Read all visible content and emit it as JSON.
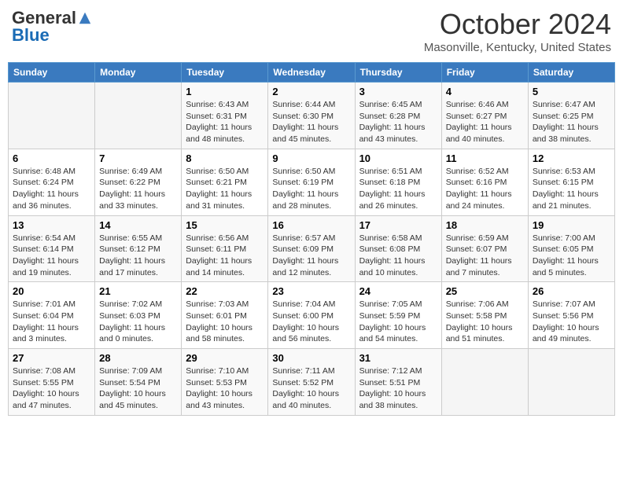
{
  "header": {
    "logo_general": "General",
    "logo_blue": "Blue",
    "month_title": "October 2024",
    "location": "Masonville, Kentucky, United States"
  },
  "weekdays": [
    "Sunday",
    "Monday",
    "Tuesday",
    "Wednesday",
    "Thursday",
    "Friday",
    "Saturday"
  ],
  "weeks": [
    [
      {
        "day": "",
        "sunrise": "",
        "sunset": "",
        "daylight": ""
      },
      {
        "day": "",
        "sunrise": "",
        "sunset": "",
        "daylight": ""
      },
      {
        "day": "1",
        "sunrise": "Sunrise: 6:43 AM",
        "sunset": "Sunset: 6:31 PM",
        "daylight": "Daylight: 11 hours and 48 minutes."
      },
      {
        "day": "2",
        "sunrise": "Sunrise: 6:44 AM",
        "sunset": "Sunset: 6:30 PM",
        "daylight": "Daylight: 11 hours and 45 minutes."
      },
      {
        "day": "3",
        "sunrise": "Sunrise: 6:45 AM",
        "sunset": "Sunset: 6:28 PM",
        "daylight": "Daylight: 11 hours and 43 minutes."
      },
      {
        "day": "4",
        "sunrise": "Sunrise: 6:46 AM",
        "sunset": "Sunset: 6:27 PM",
        "daylight": "Daylight: 11 hours and 40 minutes."
      },
      {
        "day": "5",
        "sunrise": "Sunrise: 6:47 AM",
        "sunset": "Sunset: 6:25 PM",
        "daylight": "Daylight: 11 hours and 38 minutes."
      }
    ],
    [
      {
        "day": "6",
        "sunrise": "Sunrise: 6:48 AM",
        "sunset": "Sunset: 6:24 PM",
        "daylight": "Daylight: 11 hours and 36 minutes."
      },
      {
        "day": "7",
        "sunrise": "Sunrise: 6:49 AM",
        "sunset": "Sunset: 6:22 PM",
        "daylight": "Daylight: 11 hours and 33 minutes."
      },
      {
        "day": "8",
        "sunrise": "Sunrise: 6:50 AM",
        "sunset": "Sunset: 6:21 PM",
        "daylight": "Daylight: 11 hours and 31 minutes."
      },
      {
        "day": "9",
        "sunrise": "Sunrise: 6:50 AM",
        "sunset": "Sunset: 6:19 PM",
        "daylight": "Daylight: 11 hours and 28 minutes."
      },
      {
        "day": "10",
        "sunrise": "Sunrise: 6:51 AM",
        "sunset": "Sunset: 6:18 PM",
        "daylight": "Daylight: 11 hours and 26 minutes."
      },
      {
        "day": "11",
        "sunrise": "Sunrise: 6:52 AM",
        "sunset": "Sunset: 6:16 PM",
        "daylight": "Daylight: 11 hours and 24 minutes."
      },
      {
        "day": "12",
        "sunrise": "Sunrise: 6:53 AM",
        "sunset": "Sunset: 6:15 PM",
        "daylight": "Daylight: 11 hours and 21 minutes."
      }
    ],
    [
      {
        "day": "13",
        "sunrise": "Sunrise: 6:54 AM",
        "sunset": "Sunset: 6:14 PM",
        "daylight": "Daylight: 11 hours and 19 minutes."
      },
      {
        "day": "14",
        "sunrise": "Sunrise: 6:55 AM",
        "sunset": "Sunset: 6:12 PM",
        "daylight": "Daylight: 11 hours and 17 minutes."
      },
      {
        "day": "15",
        "sunrise": "Sunrise: 6:56 AM",
        "sunset": "Sunset: 6:11 PM",
        "daylight": "Daylight: 11 hours and 14 minutes."
      },
      {
        "day": "16",
        "sunrise": "Sunrise: 6:57 AM",
        "sunset": "Sunset: 6:09 PM",
        "daylight": "Daylight: 11 hours and 12 minutes."
      },
      {
        "day": "17",
        "sunrise": "Sunrise: 6:58 AM",
        "sunset": "Sunset: 6:08 PM",
        "daylight": "Daylight: 11 hours and 10 minutes."
      },
      {
        "day": "18",
        "sunrise": "Sunrise: 6:59 AM",
        "sunset": "Sunset: 6:07 PM",
        "daylight": "Daylight: 11 hours and 7 minutes."
      },
      {
        "day": "19",
        "sunrise": "Sunrise: 7:00 AM",
        "sunset": "Sunset: 6:05 PM",
        "daylight": "Daylight: 11 hours and 5 minutes."
      }
    ],
    [
      {
        "day": "20",
        "sunrise": "Sunrise: 7:01 AM",
        "sunset": "Sunset: 6:04 PM",
        "daylight": "Daylight: 11 hours and 3 minutes."
      },
      {
        "day": "21",
        "sunrise": "Sunrise: 7:02 AM",
        "sunset": "Sunset: 6:03 PM",
        "daylight": "Daylight: 11 hours and 0 minutes."
      },
      {
        "day": "22",
        "sunrise": "Sunrise: 7:03 AM",
        "sunset": "Sunset: 6:01 PM",
        "daylight": "Daylight: 10 hours and 58 minutes."
      },
      {
        "day": "23",
        "sunrise": "Sunrise: 7:04 AM",
        "sunset": "Sunset: 6:00 PM",
        "daylight": "Daylight: 10 hours and 56 minutes."
      },
      {
        "day": "24",
        "sunrise": "Sunrise: 7:05 AM",
        "sunset": "Sunset: 5:59 PM",
        "daylight": "Daylight: 10 hours and 54 minutes."
      },
      {
        "day": "25",
        "sunrise": "Sunrise: 7:06 AM",
        "sunset": "Sunset: 5:58 PM",
        "daylight": "Daylight: 10 hours and 51 minutes."
      },
      {
        "day": "26",
        "sunrise": "Sunrise: 7:07 AM",
        "sunset": "Sunset: 5:56 PM",
        "daylight": "Daylight: 10 hours and 49 minutes."
      }
    ],
    [
      {
        "day": "27",
        "sunrise": "Sunrise: 7:08 AM",
        "sunset": "Sunset: 5:55 PM",
        "daylight": "Daylight: 10 hours and 47 minutes."
      },
      {
        "day": "28",
        "sunrise": "Sunrise: 7:09 AM",
        "sunset": "Sunset: 5:54 PM",
        "daylight": "Daylight: 10 hours and 45 minutes."
      },
      {
        "day": "29",
        "sunrise": "Sunrise: 7:10 AM",
        "sunset": "Sunset: 5:53 PM",
        "daylight": "Daylight: 10 hours and 43 minutes."
      },
      {
        "day": "30",
        "sunrise": "Sunrise: 7:11 AM",
        "sunset": "Sunset: 5:52 PM",
        "daylight": "Daylight: 10 hours and 40 minutes."
      },
      {
        "day": "31",
        "sunrise": "Sunrise: 7:12 AM",
        "sunset": "Sunset: 5:51 PM",
        "daylight": "Daylight: 10 hours and 38 minutes."
      },
      {
        "day": "",
        "sunrise": "",
        "sunset": "",
        "daylight": ""
      },
      {
        "day": "",
        "sunrise": "",
        "sunset": "",
        "daylight": ""
      }
    ]
  ]
}
